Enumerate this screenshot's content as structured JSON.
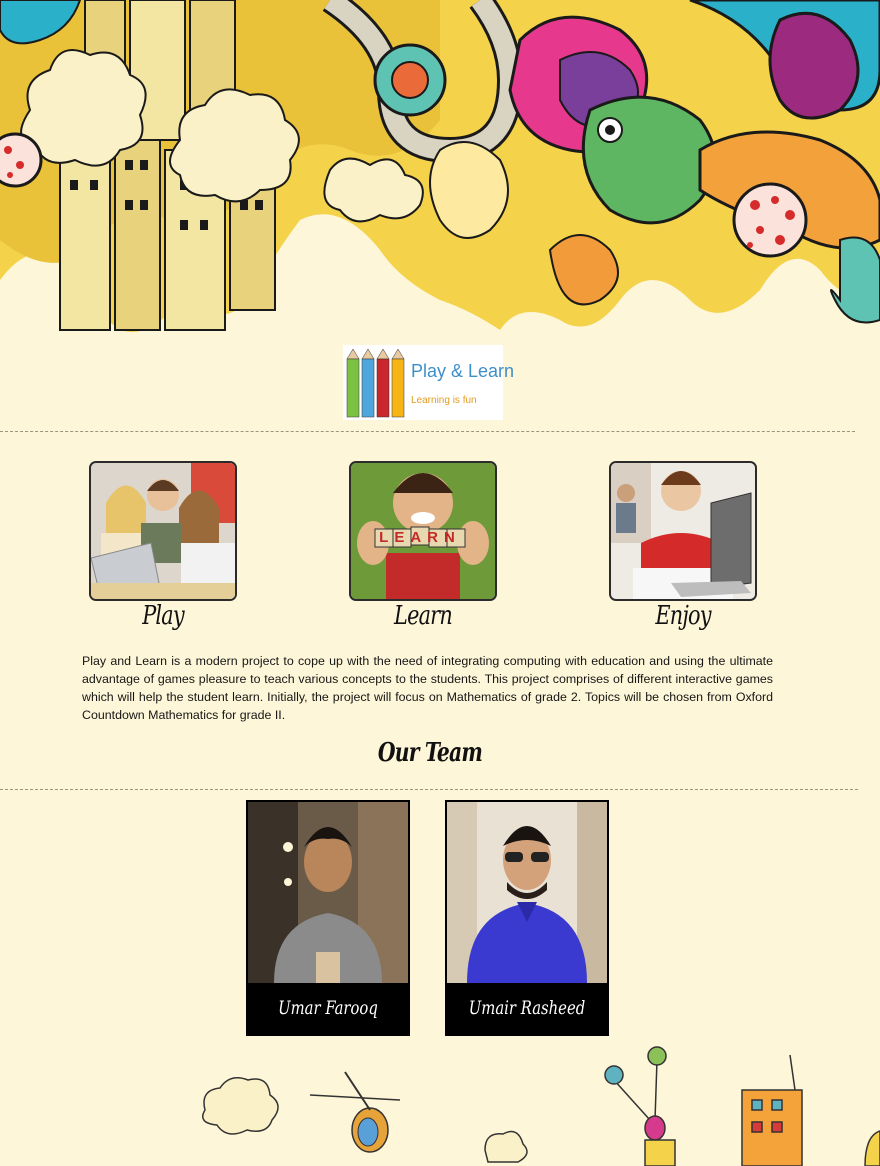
{
  "logo": {
    "title": "Play & Learn",
    "tagline": "Learning is fun",
    "pencil_colors": [
      "#7cc242",
      "#4ea6dc",
      "#c9262d",
      "#f6b417"
    ]
  },
  "features": [
    {
      "label": "Play"
    },
    {
      "label": "Learn",
      "photo_text": "LEARN"
    },
    {
      "label": "Enjoy"
    }
  ],
  "description": "Play and Learn is a modern project to cope up with the need of integrating computing with education and using the ultimate advantage of games pleasure to teach various concepts to the students. This project comprises of different interactive games which will help the student learn. Initially, the project will focus on Mathematics of grade 2. Topics will be chosen from Oxford Countdown Mathematics for grade II.",
  "team": {
    "heading": "Our Team",
    "members": [
      {
        "name": "Umar Farooq"
      },
      {
        "name": "Umair Rasheed"
      }
    ]
  },
  "colors": {
    "page_background": "#fdf6d8",
    "logo_blue": "#3d8fc9",
    "logo_orange": "#e39b1f"
  }
}
